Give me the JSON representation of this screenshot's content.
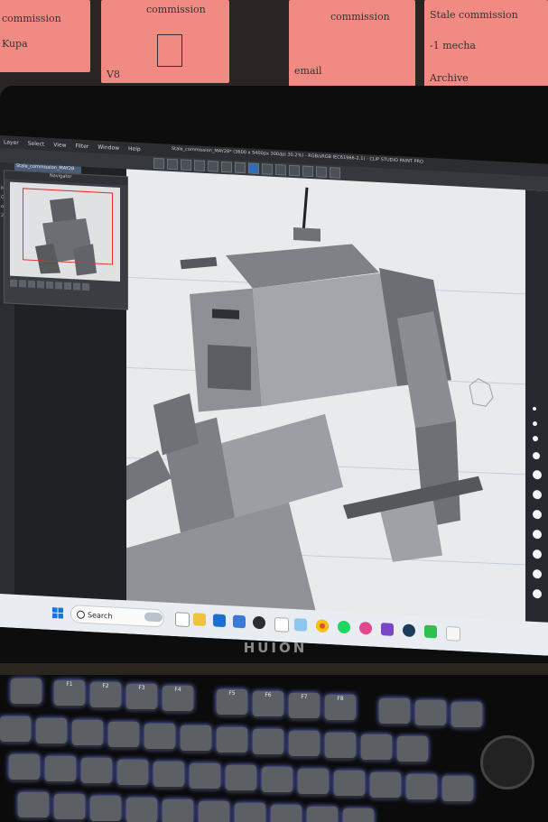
{
  "sticky_notes": [
    {
      "line1": "commission",
      "line2": "Kupa"
    },
    {
      "line1": "commission",
      "line2": "V8"
    },
    {
      "line1": "commission",
      "line2": "email"
    },
    {
      "line1": "Stale commission",
      "line2": "-1 mecha",
      "line3": "Archive"
    }
  ],
  "app": {
    "menu": [
      "Layer",
      "Select",
      "View",
      "Filter",
      "Window",
      "Help"
    ],
    "title": "Stale_commission_MAY28* (3600 x 5400px 300dpi 30.2%) - RGB/sRGB IEC61966-2.1) - CLIP STUDIO PAINT PRO",
    "document_tab": "Stale_commission_MAY28",
    "navigator_title": "Navigator",
    "left_panel_labels": [
      "Maker",
      "Green",
      "on 3",
      "2"
    ]
  },
  "taskbar": {
    "search_placeholder": "Search",
    "icons": [
      "windows-start-icon",
      "weather-widget-icon",
      "file-explorer-icon",
      "chrome-icon",
      "spotify-icon",
      "steam-icon"
    ]
  },
  "monitor_brand": "HUION",
  "keyboard_keys": [
    "F1",
    "F2",
    "F3",
    "F4",
    "F5",
    "F6",
    "F7",
    "F8"
  ],
  "colors": {
    "sticky_note": "#f08a83",
    "canvas_bg": "#e8eaec",
    "navigator_frame": "#e03030",
    "keyboard_glow": "#7a8cff"
  }
}
